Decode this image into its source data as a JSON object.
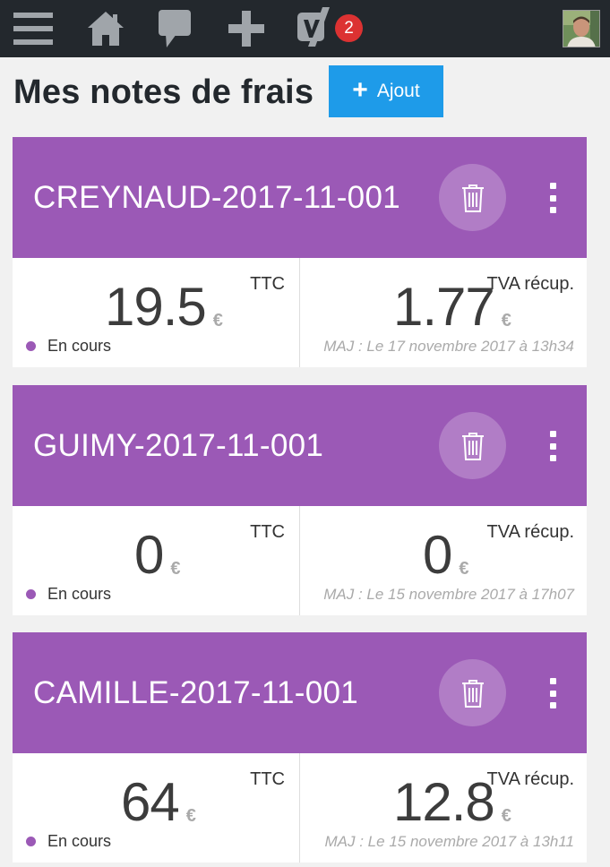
{
  "adminbar": {
    "icons": [
      "menu-icon",
      "home-icon",
      "comment-icon",
      "plus-icon",
      "yoast-icon",
      "avatar"
    ],
    "notification_count": "2",
    "badge_color": "#dc3232"
  },
  "page": {
    "title": "Mes notes de frais",
    "add_button_label": "Ajout",
    "accent_color": "#9b59b6",
    "button_color": "#1e9be9"
  },
  "cards": [
    {
      "title": "CREYNAUD-2017-11-001",
      "ttc_label": "TTC",
      "ttc_value": "19.5",
      "currency": "€",
      "tva_label": "TVA récup.",
      "tva_value": "1.77",
      "status": "En cours",
      "updated": "MAJ : Le 17 novembre 2017 à 13h34"
    },
    {
      "title": "GUIMY-2017-11-001",
      "ttc_label": "TTC",
      "ttc_value": "0",
      "currency": "€",
      "tva_label": "TVA récup.",
      "tva_value": "0",
      "status": "En cours",
      "updated": "MAJ : Le 15 novembre 2017 à 17h07"
    },
    {
      "title": "CAMILLE-2017-11-001",
      "ttc_label": "TTC",
      "ttc_value": "64",
      "currency": "€",
      "tva_label": "TVA récup.",
      "tva_value": "12.8",
      "status": "En cours",
      "updated": "MAJ : Le 15 novembre 2017 à 13h11"
    }
  ]
}
